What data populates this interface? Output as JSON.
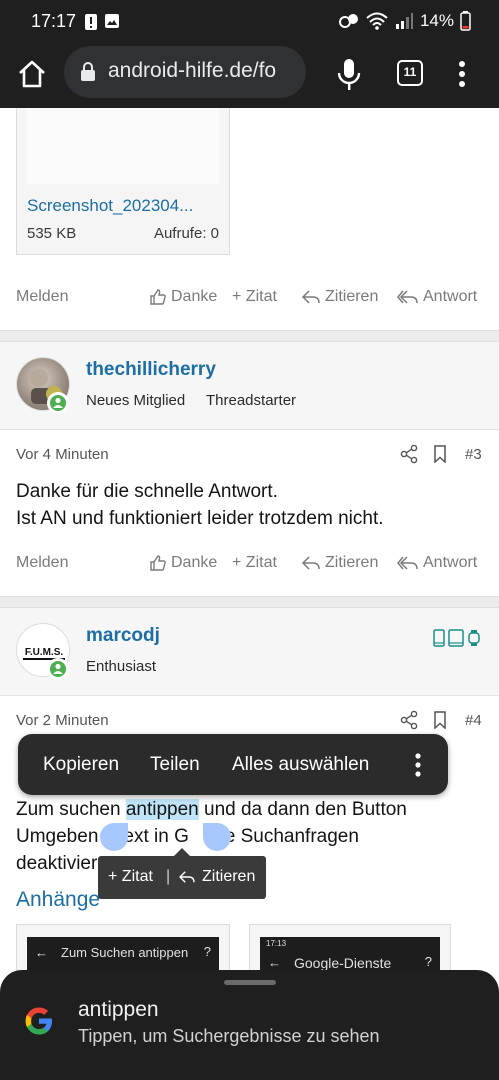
{
  "status_bar": {
    "time": "17:17",
    "battery": "14%"
  },
  "browser": {
    "url": "android-hilfe.de/fo",
    "tab_count": "11"
  },
  "attachment": {
    "name": "Screenshot_202304...",
    "size": "535 KB",
    "views": "Aufrufe: 0"
  },
  "actions": {
    "melden": "Melden",
    "danke": "Danke",
    "zitat": "+ Zitat",
    "zitieren": "Zitieren",
    "antwort": "Antwort"
  },
  "post3": {
    "username": "thechillicherry",
    "user_title": "Neues Mitglied",
    "badge": "Threadstarter",
    "time": "Vor 4 Minuten",
    "number": "#3",
    "line1": "Danke für die schnelle Antwort.",
    "line2": "Ist AN und funktioniert leider trotzdem nicht."
  },
  "post4": {
    "username": "marcodj",
    "user_title": "Enthusiast",
    "avatar_text": "F.U.M.S.",
    "time": "Vor 2 Minuten",
    "number": "#4",
    "text_before": "Zum suchen ",
    "text_selected": "antippen",
    "text_after": " und da dann den Button",
    "line2": "Umgeben   Text in G    gle Suchanfragen",
    "line3": "deaktivieren",
    "attachments_heading": "Anhänge",
    "thumb1_label": "Zum Suchen antippen",
    "thumb2_label": "Google-Dienste",
    "thumb2_status": "17:13"
  },
  "context_menu": {
    "copy": "Kopieren",
    "share": "Teilen",
    "select_all": "Alles auswählen"
  },
  "quote_popup": {
    "zitat": "+ Zitat",
    "separator": "|",
    "zitieren": "Zitieren"
  },
  "bottom_sheet": {
    "title": "antippen",
    "subtitle": "Tippen, um Suchergebnisse zu sehen"
  },
  "colors": {
    "link": "#1c6ea4",
    "selection": "#bfe3f7",
    "handle": "#a8c7fa",
    "chrome": "#1f1f1f",
    "online": "#4caf50"
  }
}
